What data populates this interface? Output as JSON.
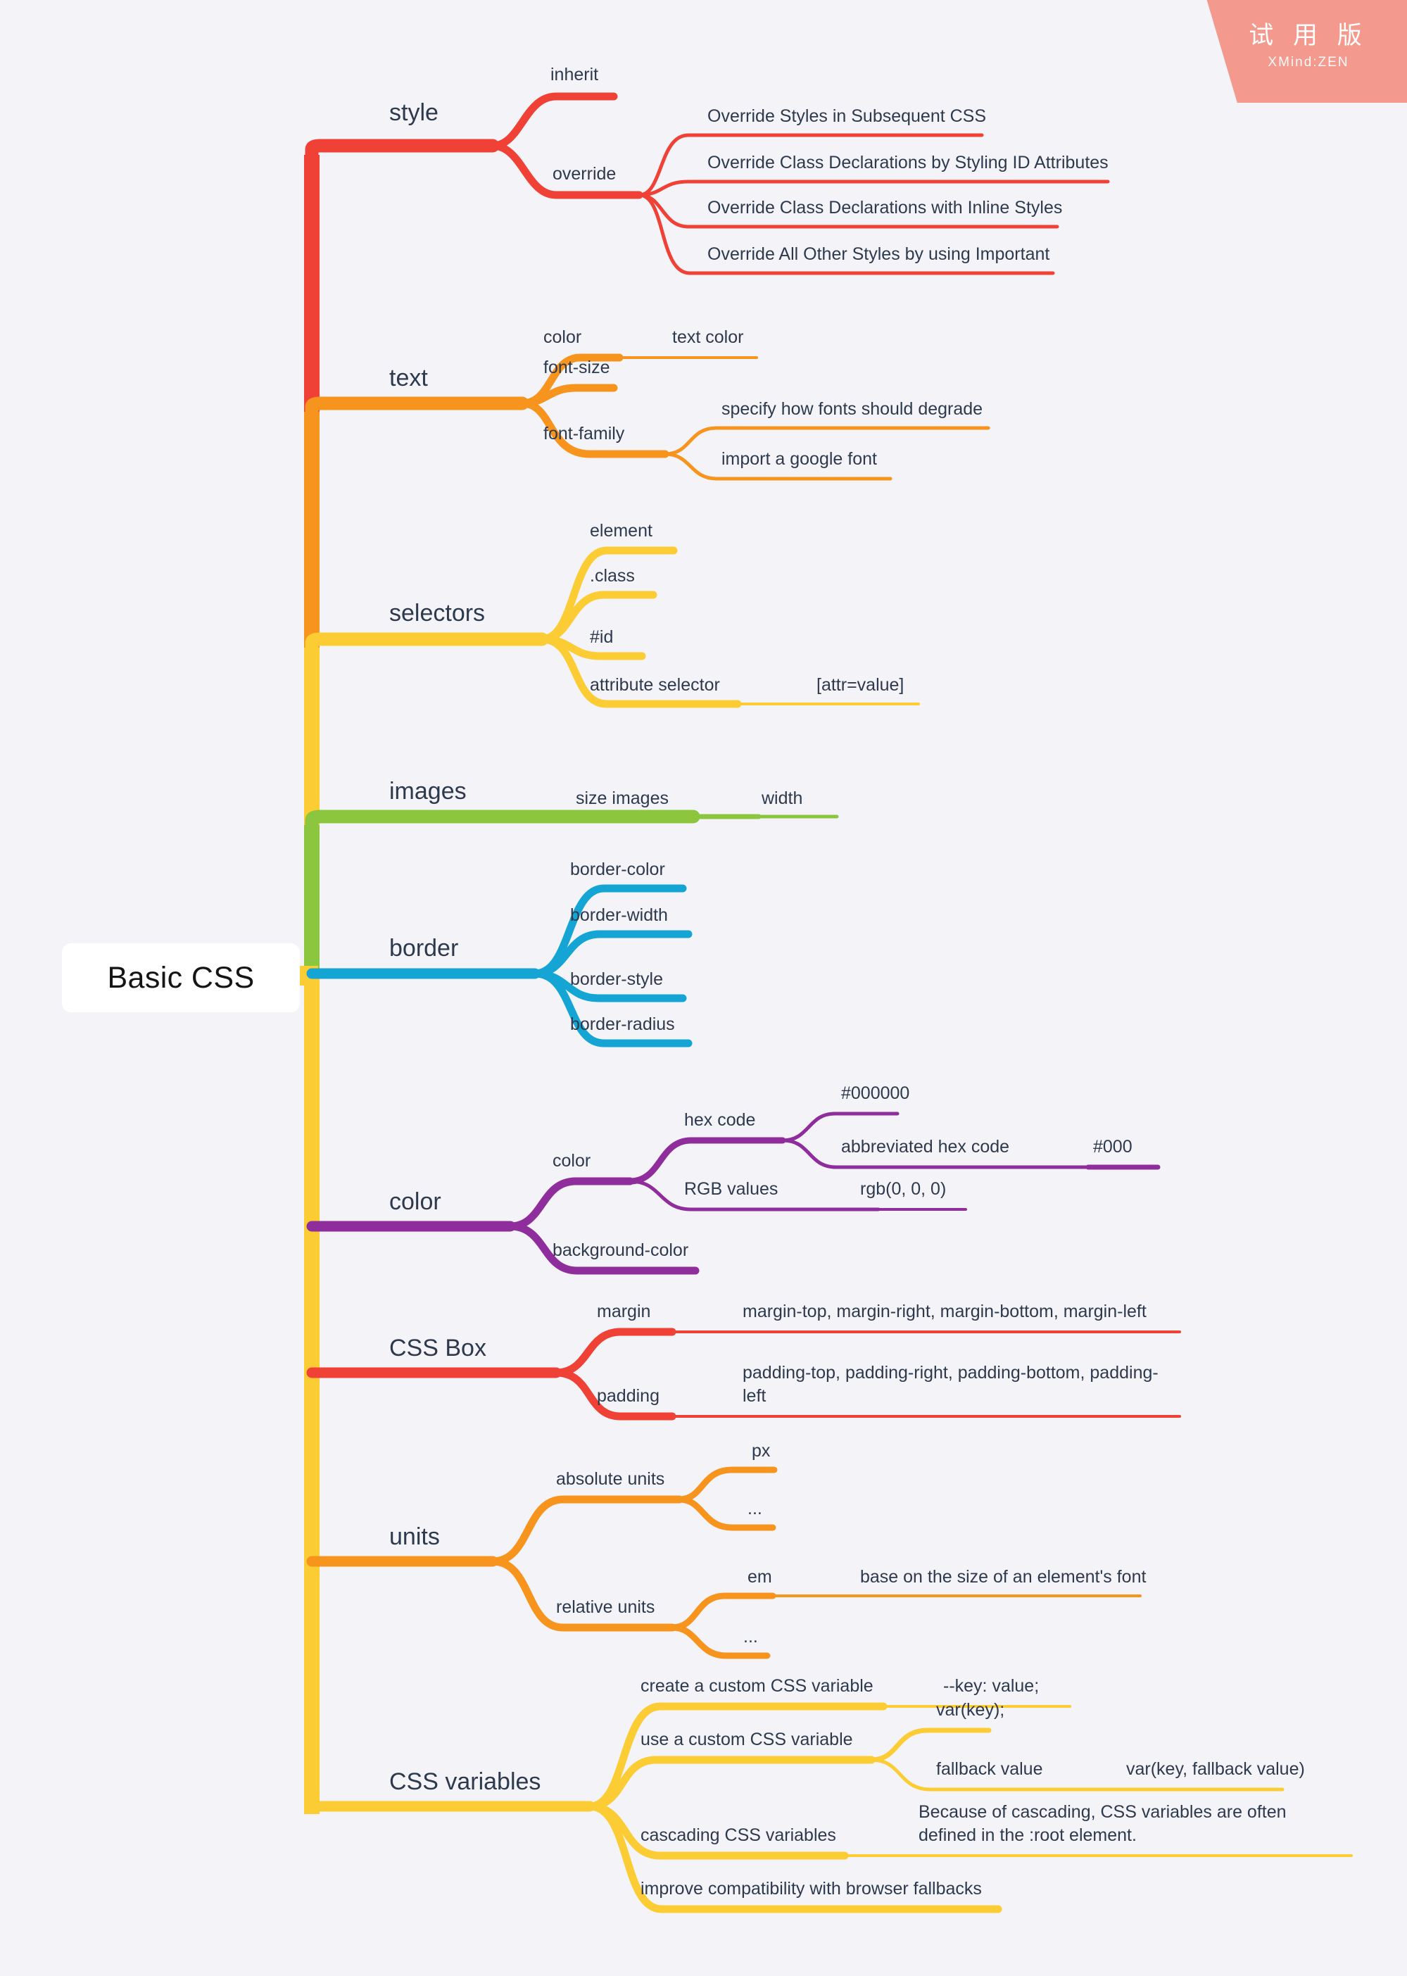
{
  "watermark": {
    "name": "trial-version-badge",
    "cn_text": "试 用 版",
    "en_text": "XMind:ZEN",
    "color": "#f4998d"
  },
  "root": {
    "label": "Basic CSS"
  },
  "theme": {
    "background": "#f4f4f8",
    "text_color": "#2d3a4d",
    "root_bg": "#ffffff"
  },
  "branches": [
    {
      "label": "style",
      "color": "#ef4136",
      "children": [
        {
          "label": "inherit",
          "children": []
        },
        {
          "label": "override",
          "children": [
            {
              "label": "Override Styles in Subsequent CSS"
            },
            {
              "label": "Override Class Declarations by Styling ID Attributes"
            },
            {
              "label": "Override Class Declarations with Inline Styles"
            },
            {
              "label": "Override All Other Styles by using Important"
            }
          ]
        }
      ]
    },
    {
      "label": "text",
      "color": "#f7941e",
      "children": [
        {
          "label": "color",
          "children": [
            {
              "label": "text color"
            }
          ]
        },
        {
          "label": "font-size",
          "children": []
        },
        {
          "label": "font-family",
          "children": [
            {
              "label": "specify how fonts should degrade"
            },
            {
              "label": "import a google font"
            }
          ]
        }
      ]
    },
    {
      "label": "selectors",
      "color": "#fbcc34",
      "children": [
        {
          "label": "element",
          "children": []
        },
        {
          "label": ".class",
          "children": []
        },
        {
          "label": "#id",
          "children": []
        },
        {
          "label": "attribute selector",
          "children": [
            {
              "label": "[attr=value]"
            }
          ]
        }
      ]
    },
    {
      "label": "images",
      "color": "#8cc63e",
      "children": [
        {
          "label": "size images",
          "children": [
            {
              "label": "width"
            }
          ]
        }
      ]
    },
    {
      "label": "border",
      "color": "#14a5d4",
      "children": [
        {
          "label": "border-color",
          "children": []
        },
        {
          "label": "border-width",
          "children": []
        },
        {
          "label": "border-style",
          "children": []
        },
        {
          "label": "border-radius",
          "children": []
        }
      ]
    },
    {
      "label": "color",
      "color": "#8f2d9c",
      "children": [
        {
          "label": "color",
          "children": [
            {
              "label": "hex code",
              "children": [
                {
                  "label": "#000000"
                },
                {
                  "label": "abbreviated hex code",
                  "children": [
                    {
                      "label": "#000"
                    }
                  ]
                }
              ]
            },
            {
              "label": "RGB values",
              "children": [
                {
                  "label": "rgb(0, 0, 0)"
                }
              ]
            }
          ]
        },
        {
          "label": "background-color",
          "children": []
        }
      ]
    },
    {
      "label": "CSS Box",
      "color": "#ef4136",
      "children": [
        {
          "label": "margin",
          "children": [
            {
              "label": "margin-top, margin-right, margin-bottom, margin-left"
            }
          ]
        },
        {
          "label": "padding",
          "children": [
            {
              "label": "padding-top, padding-right, padding-bottom, padding-left"
            }
          ]
        }
      ]
    },
    {
      "label": "units",
      "color": "#f7941e",
      "children": [
        {
          "label": "absolute units",
          "children": [
            {
              "label": "px"
            },
            {
              "label": "..."
            }
          ]
        },
        {
          "label": "relative units",
          "children": [
            {
              "label": "em",
              "children": [
                {
                  "label": "base on the size of an element's font"
                }
              ]
            },
            {
              "label": "..."
            }
          ]
        }
      ]
    },
    {
      "label": "CSS variables",
      "color": "#fbcc34",
      "children": [
        {
          "label": "create a custom CSS variable",
          "children": [
            {
              "label": "--key: value;"
            }
          ]
        },
        {
          "label": "use a custom CSS variable",
          "children": [
            {
              "label": "var(key);"
            },
            {
              "label": "fallback value",
              "children": [
                {
                  "label": "var(key, fallback value)"
                }
              ]
            }
          ]
        },
        {
          "label": "cascading CSS variables",
          "children": [
            {
              "label": "Because of cascading, CSS variables are often defined in the :root element."
            }
          ]
        },
        {
          "label": "improve compatibility with browser fallbacks",
          "children": []
        }
      ]
    }
  ]
}
